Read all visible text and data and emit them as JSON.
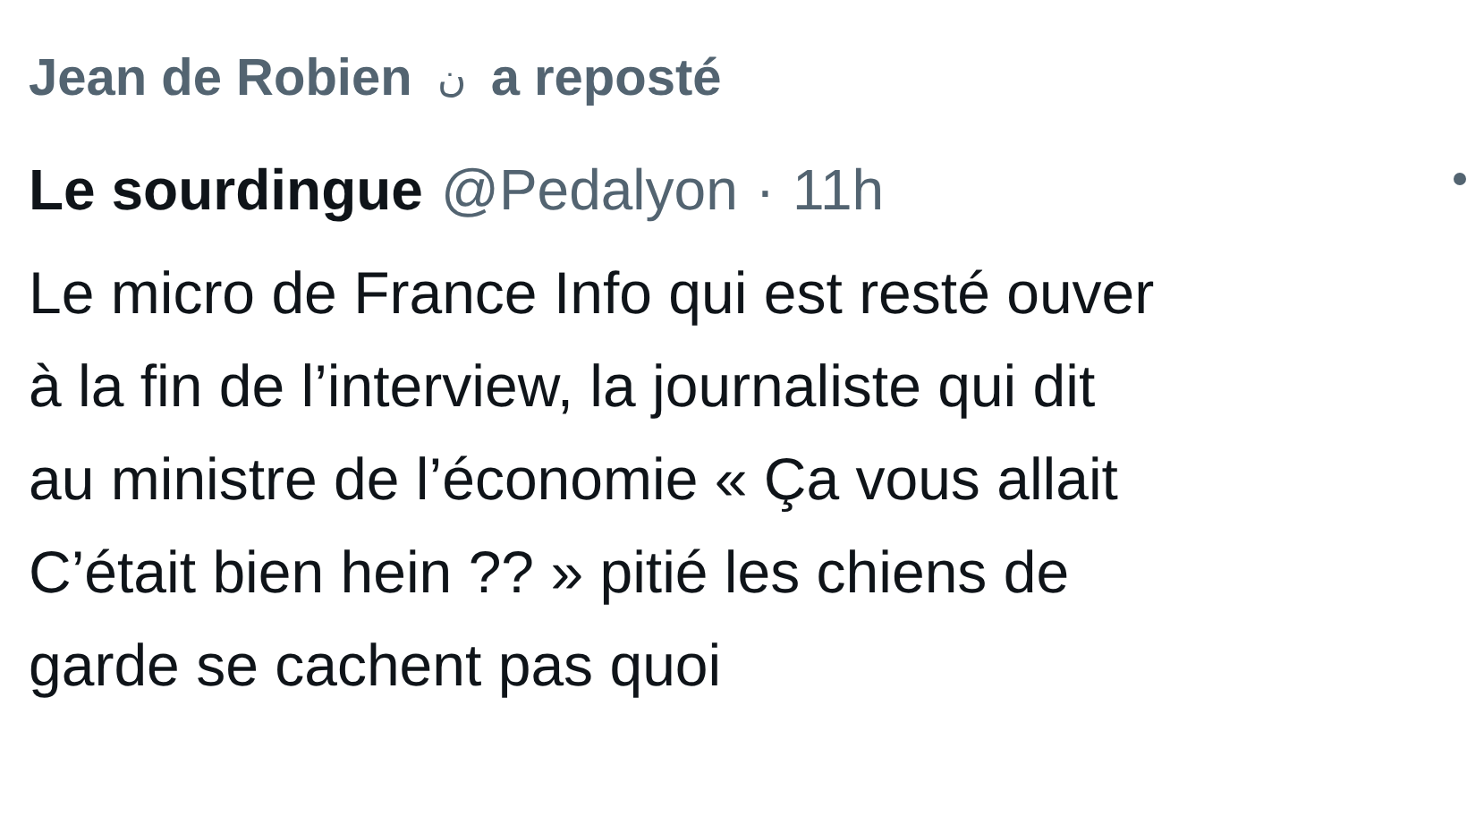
{
  "repost_header": {
    "name": "Jean de Robien",
    "icon_glyph": "ن",
    "label": "a reposté"
  },
  "post": {
    "author": "Le sourdingue",
    "handle": "@Pedalyon",
    "separator": "·",
    "time": "11h",
    "lines": [
      "Le micro de France Info qui est resté ouver",
      "à la fin de l’interview, la journaliste qui dit",
      "au ministre de l’économie « Ça vous allait",
      "C’était bien hein ?? » pitié les chiens de",
      "garde se cachent pas quoi"
    ]
  }
}
